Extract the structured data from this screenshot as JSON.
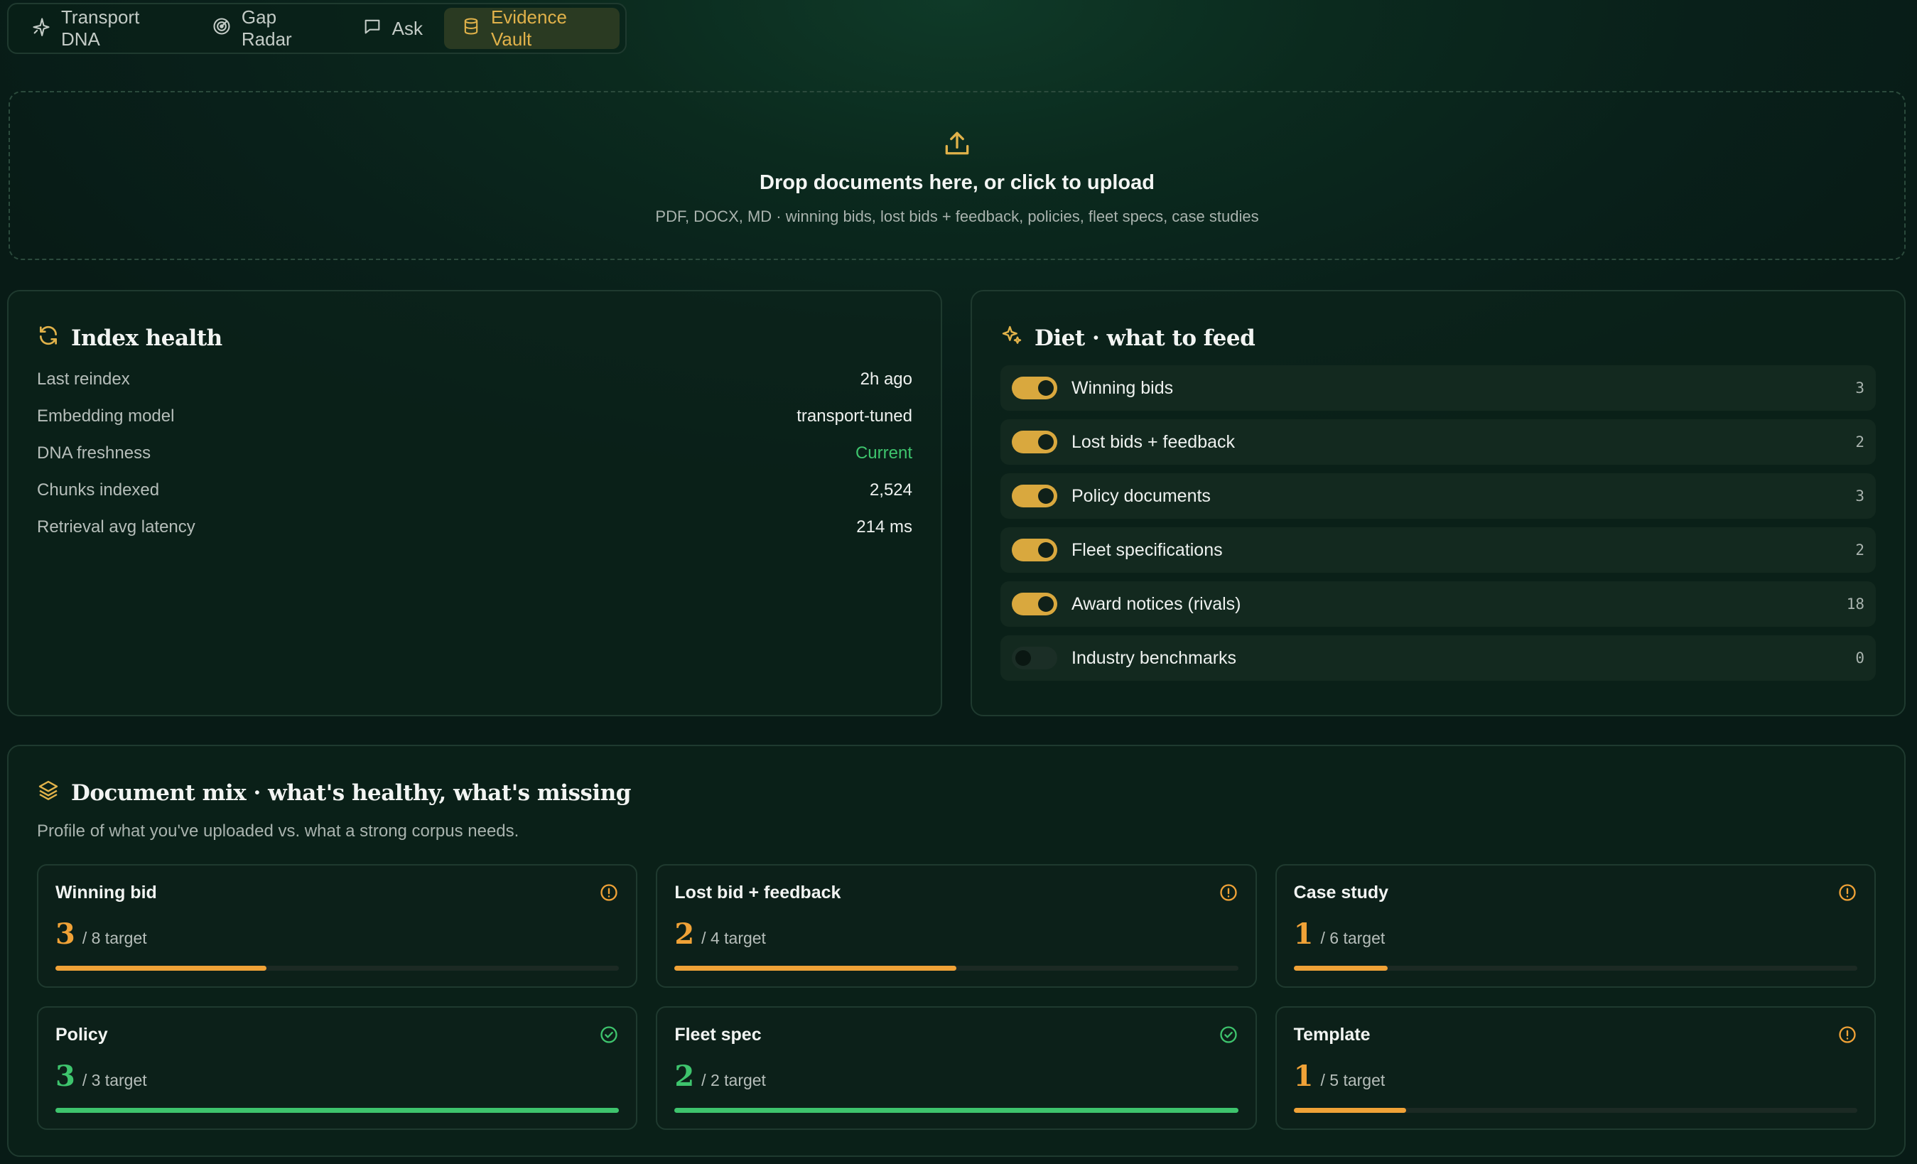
{
  "nav": {
    "tabs": [
      {
        "label": "Transport DNA",
        "icon": "sparkle-icon",
        "active": false
      },
      {
        "label": "Gap Radar",
        "icon": "radar-icon",
        "active": false
      },
      {
        "label": "Ask",
        "icon": "chat-bubble-icon",
        "active": false
      },
      {
        "label": "Evidence Vault",
        "icon": "database-icon",
        "active": true
      }
    ]
  },
  "upload": {
    "title": "Drop documents here, or click to upload",
    "subtitle": "PDF, DOCX, MD · winning bids, lost bids + feedback, policies, fleet specs, case studies"
  },
  "index_health": {
    "title": "Index health",
    "rows": [
      {
        "label": "Last reindex",
        "value": "2h ago"
      },
      {
        "label": "Embedding model",
        "value": "transport-tuned"
      },
      {
        "label": "DNA freshness",
        "value": "Current"
      },
      {
        "label": "Chunks indexed",
        "value": "2,524"
      },
      {
        "label": "Retrieval avg latency",
        "value": "214 ms"
      }
    ]
  },
  "diet": {
    "title": "Diet · what to feed",
    "items": [
      {
        "label": "Winning bids",
        "count": "3",
        "enabled": true
      },
      {
        "label": "Lost bids + feedback",
        "count": "2",
        "enabled": true
      },
      {
        "label": "Policy documents",
        "count": "3",
        "enabled": true
      },
      {
        "label": "Fleet specifications",
        "count": "2",
        "enabled": true
      },
      {
        "label": "Award notices (rivals)",
        "count": "18",
        "enabled": true
      },
      {
        "label": "Industry benchmarks",
        "count": "0",
        "enabled": false
      }
    ]
  },
  "mix": {
    "title": "Document mix · what's healthy, what's missing",
    "subtitle": "Profile of what you've uploaded vs. what a strong corpus needs.",
    "cards": [
      {
        "title": "Winning bid",
        "count": "3",
        "target": "/ 8 target",
        "fraction": 0.375,
        "status": "warning"
      },
      {
        "title": "Lost bid + feedback",
        "count": "2",
        "target": "/ 4 target",
        "fraction": 0.5,
        "status": "warning"
      },
      {
        "title": "Case study",
        "count": "1",
        "target": "/ 6 target",
        "fraction": 0.167,
        "status": "warning"
      },
      {
        "title": "Policy",
        "count": "3",
        "target": "/ 3 target",
        "fraction": 1.0,
        "status": "ok"
      },
      {
        "title": "Fleet spec",
        "count": "2",
        "target": "/ 2 target",
        "fraction": 1.0,
        "status": "ok"
      },
      {
        "title": "Template",
        "count": "1",
        "target": "/ 5 target",
        "fraction": 0.2,
        "status": "warning"
      }
    ]
  },
  "colors": {
    "accent": "#e1b24a",
    "warning": "#f0a237",
    "ok": "#3ec46d",
    "background": "#0b2a1e"
  }
}
